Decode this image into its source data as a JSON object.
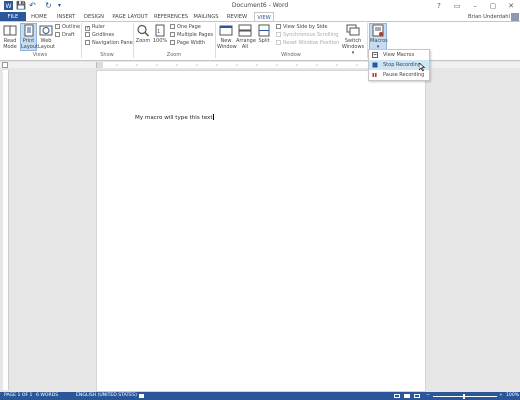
{
  "window": {
    "title": "Document6 - Word",
    "help": "?",
    "ribbon_display": "▭",
    "minimize": "–",
    "restore": "▢",
    "close": "✕"
  },
  "quick_access": {
    "save": "💾",
    "undo": "↶",
    "redo": "↻",
    "customize": "▾"
  },
  "tabs": [
    "FILE",
    "HOME",
    "INSERT",
    "DESIGN",
    "PAGE LAYOUT",
    "REFERENCES",
    "MAILINGS",
    "REVIEW",
    "VIEW"
  ],
  "user": {
    "name": "Brian Underdahl"
  },
  "ribbon": {
    "views": {
      "read_mode": "Read\nMode",
      "print_layout": "Print\nLayout",
      "web_layout": "Web\nLayout",
      "outline": "Outline",
      "draft": "Draft",
      "group": "Views"
    },
    "show": {
      "ruler": "Ruler",
      "gridlines": "Gridlines",
      "navigation_pane": "Navigation Pane",
      "ruler_checked": true,
      "group": "Show"
    },
    "zoom": {
      "zoom": "Zoom",
      "zoom_100": "100%",
      "one_page": "One Page",
      "multiple_pages": "Multiple Pages",
      "page_width": "Page Width",
      "group": "Zoom"
    },
    "window": {
      "new_window": "New\nWindow",
      "arrange_all": "Arrange\nAll",
      "split": "Split",
      "side_by_side": "View Side by Side",
      "sync_scrolling": "Synchronous Scrolling",
      "reset_position": "Reset Window Position",
      "switch_windows": "Switch\nWindows ▾",
      "group": "Window"
    },
    "macros": {
      "label": "Macros",
      "arrow": "▾"
    }
  },
  "macros_menu": {
    "items": [
      "View Macros",
      "Stop Recording",
      "Pause Recording"
    ],
    "selected": "Stop Recording"
  },
  "document": {
    "text": "My macro will type this text"
  },
  "status": {
    "page": "PAGE 1 OF 1",
    "words": "6 WORDS",
    "language": "ENGLISH (UNITED STATES)",
    "zoom": "100%"
  },
  "colors": {
    "accent": "#2b579a",
    "record_red": "#c0392b",
    "highlight": "#cde6f7"
  }
}
